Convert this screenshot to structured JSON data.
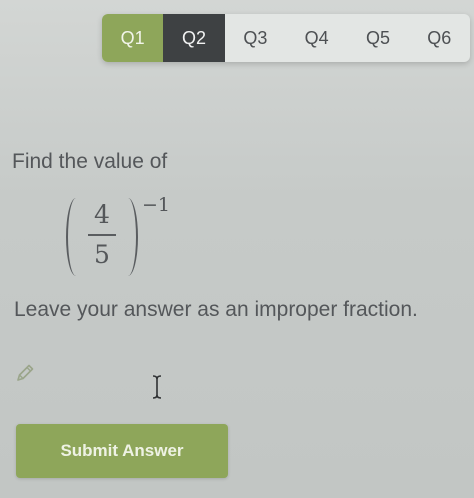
{
  "tabs": [
    {
      "label": "Q1",
      "state": "answered"
    },
    {
      "label": "Q2",
      "state": "current"
    },
    {
      "label": "Q3",
      "state": "pending"
    },
    {
      "label": "Q4",
      "state": "pending"
    },
    {
      "label": "Q5",
      "state": "pending"
    },
    {
      "label": "Q6",
      "state": "pending"
    }
  ],
  "question": {
    "prompt": "Find the value of",
    "expression": {
      "numerator": "4",
      "denominator": "5",
      "exponent": "−1"
    },
    "instruction": "Leave your answer as an improper fraction."
  },
  "answer": {
    "edit_icon": "pencil-icon",
    "cursor_icon": "text-cursor-icon",
    "value": ""
  },
  "submit": {
    "label": "Submit Answer"
  },
  "colors": {
    "accent_green": "#8ea65a",
    "current_tab": "#3e4143",
    "text": "#54575a"
  }
}
